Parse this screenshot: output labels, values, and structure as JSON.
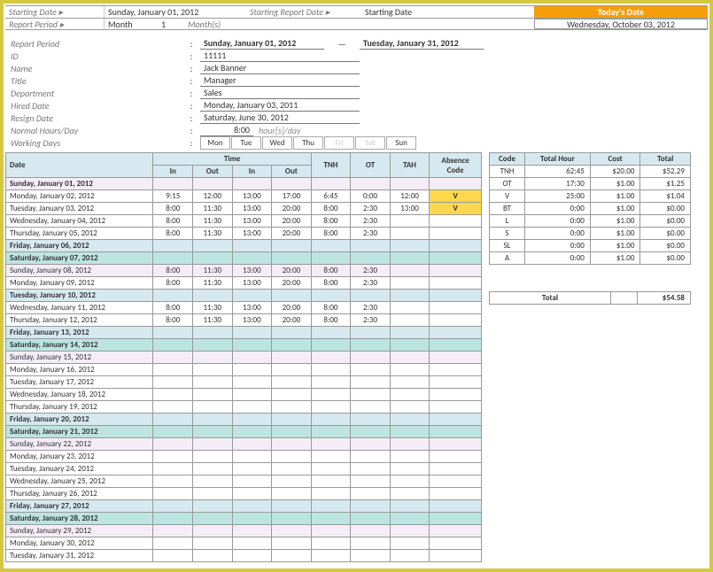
{
  "header": {
    "startDateLabel": "Starting Date ▸",
    "startDateValue": "Sunday, January 01, 2012",
    "startReportLabel": "Starting Report Date ▸",
    "startReportValue": "Starting Date",
    "todayLabel": "Today's Date",
    "todayValue": "Wednesday, October 03, 2012",
    "reportPeriodLabel": "Report Period ▸",
    "reportPeriodUnit": "Month",
    "reportPeriodCount": "1",
    "reportPeriodPlural": "Month(s)"
  },
  "meta": {
    "reportPeriodLabel": "Report Period",
    "reportPeriodFrom": "Sunday, January 01, 2012",
    "reportPeriodTo": "Tuesday, January 31, 2012",
    "idLabel": "ID",
    "id": "11111",
    "nameLabel": "Name",
    "name": "Jack Banner",
    "titleLabel": "Title",
    "title": "Manager",
    "deptLabel": "Department",
    "dept": "Sales",
    "hiredLabel": "Hired Date",
    "hired": "Monday, January 03, 2011",
    "resignLabel": "Resign Date",
    "resign": "Saturday, June 30, 2012",
    "hoursLabel": "Normal Hours/Day",
    "hours": "8:00",
    "hoursUnit": "hour[s]/day",
    "daysLabel": "Working Days",
    "days": [
      "Mon",
      "Tue",
      "Wed",
      "Thu",
      "Fri",
      "Sat",
      "Sun"
    ],
    "daysOff": [
      false,
      false,
      false,
      false,
      true,
      true,
      false
    ]
  },
  "table": {
    "headers": {
      "date": "Date",
      "time": "Time",
      "in": "In",
      "out": "Out",
      "tnh": "TNH",
      "ot": "OT",
      "tah": "TAH",
      "abs": "Absence Code"
    },
    "rows": [
      {
        "date": "Sunday, January 01, 2012",
        "cls": "sun",
        "bold": true
      },
      {
        "date": "Monday, January 02, 2012",
        "in1": "9:15",
        "out1": "12:00",
        "in2": "13:00",
        "out2": "17:00",
        "tnh": "6:45",
        "ot": "0:00",
        "tah": "12:00",
        "abs": "V"
      },
      {
        "date": "Tuesday, January 03, 2012",
        "in1": "8:00",
        "out1": "11:30",
        "in2": "13:00",
        "out2": "20:00",
        "tnh": "8:00",
        "ot": "2:30",
        "tah": "13:00",
        "abs": "V"
      },
      {
        "date": "Wednesday, January 04, 2012",
        "in1": "8:00",
        "out1": "11:30",
        "in2": "13:00",
        "out2": "20:00",
        "tnh": "8:00",
        "ot": "2:30"
      },
      {
        "date": "Thursday, January 05, 2012",
        "in1": "8:00",
        "out1": "11:30",
        "in2": "13:00",
        "out2": "20:00",
        "tnh": "8:00",
        "ot": "2:30"
      },
      {
        "date": "Friday, January 06, 2012",
        "cls": "fri",
        "bold": true
      },
      {
        "date": "Saturday, January 07, 2012",
        "cls": "sat",
        "bold": true
      },
      {
        "date": "Sunday, January 08, 2012",
        "cls": "sun",
        "in1": "8:00",
        "out1": "11:30",
        "in2": "13:00",
        "out2": "20:00",
        "tnh": "8:00",
        "ot": "2:30"
      },
      {
        "date": "Monday, January 09, 2012",
        "in1": "8:00",
        "out1": "11:30",
        "in2": "13:00",
        "out2": "20:00",
        "tnh": "8:00",
        "ot": "2:30"
      },
      {
        "date": "Tuesday, January 10, 2012",
        "cls": "fri",
        "bold": true
      },
      {
        "date": "Wednesday, January 11, 2012",
        "in1": "8:00",
        "out1": "11:30",
        "in2": "13:00",
        "out2": "20:00",
        "tnh": "8:00",
        "ot": "2:30"
      },
      {
        "date": "Thursday, January 12, 2012",
        "in1": "8:00",
        "out1": "11:30",
        "in2": "13:00",
        "out2": "20:00",
        "tnh": "8:00",
        "ot": "2:30"
      },
      {
        "date": "Friday, January 13, 2012",
        "cls": "fri",
        "bold": true
      },
      {
        "date": "Saturday, January 14, 2012",
        "cls": "sat",
        "bold": true
      },
      {
        "date": "Sunday, January 15, 2012",
        "cls": "sun"
      },
      {
        "date": "Monday, January 16, 2012"
      },
      {
        "date": "Tuesday, January 17, 2012"
      },
      {
        "date": "Wednesday, January 18, 2012"
      },
      {
        "date": "Thursday, January 19, 2012"
      },
      {
        "date": "Friday, January 20, 2012",
        "cls": "fri",
        "bold": true
      },
      {
        "date": "Saturday, January 21, 2012",
        "cls": "sat",
        "bold": true
      },
      {
        "date": "Sunday, January 22, 2012",
        "cls": "sun"
      },
      {
        "date": "Monday, January 23, 2012"
      },
      {
        "date": "Tuesday, January 24, 2012"
      },
      {
        "date": "Wednesday, January 25, 2012"
      },
      {
        "date": "Thursday, January 26, 2012"
      },
      {
        "date": "Friday, January 27, 2012",
        "cls": "fri",
        "bold": true
      },
      {
        "date": "Saturday, January 28, 2012",
        "cls": "sat",
        "bold": true
      },
      {
        "date": "Sunday, January 29, 2012",
        "cls": "sun"
      },
      {
        "date": "Monday, January 30, 2012"
      },
      {
        "date": "Tuesday, January 31, 2012"
      }
    ]
  },
  "summary": {
    "headers": {
      "code": "Code",
      "totalHour": "Total Hour",
      "cost": "Cost",
      "total": "Total"
    },
    "rows": [
      {
        "code": "TNH",
        "hour": "62:45",
        "cost": "$20.00",
        "total": "$52.29"
      },
      {
        "code": "OT",
        "hour": "17:30",
        "cost": "$1.00",
        "total": "$1.25"
      },
      {
        "code": "V",
        "hour": "25:00",
        "cost": "$1.00",
        "total": "$1.04"
      },
      {
        "code": "BT",
        "hour": "0:00",
        "cost": "$1.00",
        "total": "$0.00"
      },
      {
        "code": "L",
        "hour": "0:00",
        "cost": "$1.00",
        "total": "$0.00"
      },
      {
        "code": "S",
        "hour": "0:00",
        "cost": "$1.00",
        "total": "$0.00"
      },
      {
        "code": "SL",
        "hour": "0:00",
        "cost": "$1.00",
        "total": "$0.00"
      },
      {
        "code": "A",
        "hour": "0:00",
        "cost": "$1.00",
        "total": "$0.00"
      }
    ],
    "totalLabel": "Total",
    "totalValue": "$54.58"
  }
}
